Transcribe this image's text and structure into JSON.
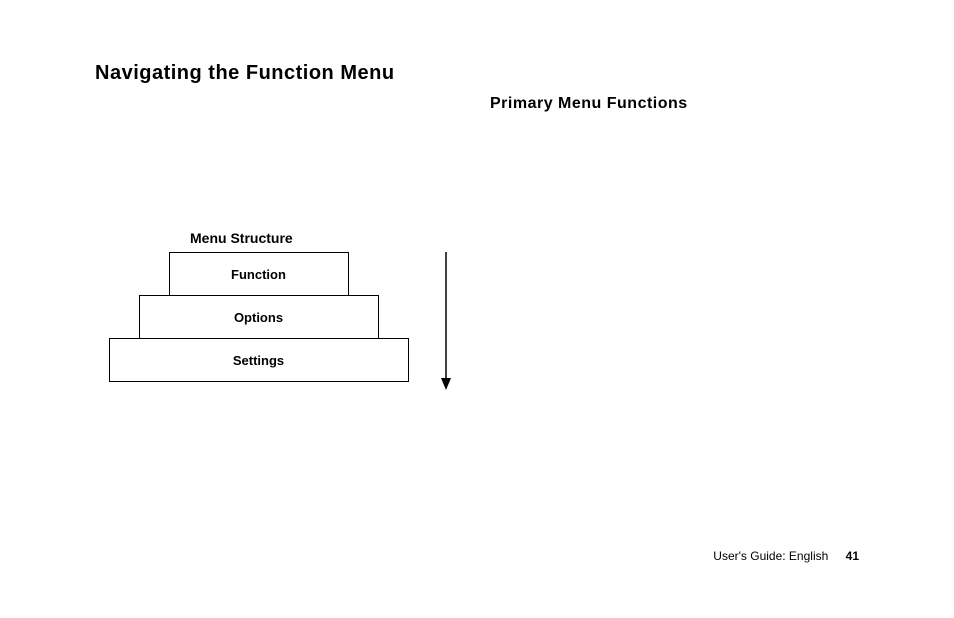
{
  "title": "Navigating the Function Menu",
  "column_heading": "Primary Menu Functions",
  "diagram": {
    "label": "Menu Structure",
    "levels": [
      "Function",
      "Options",
      "Settings"
    ]
  },
  "footer": {
    "guide_text": "User's Guide:  English",
    "page_number": "41"
  }
}
